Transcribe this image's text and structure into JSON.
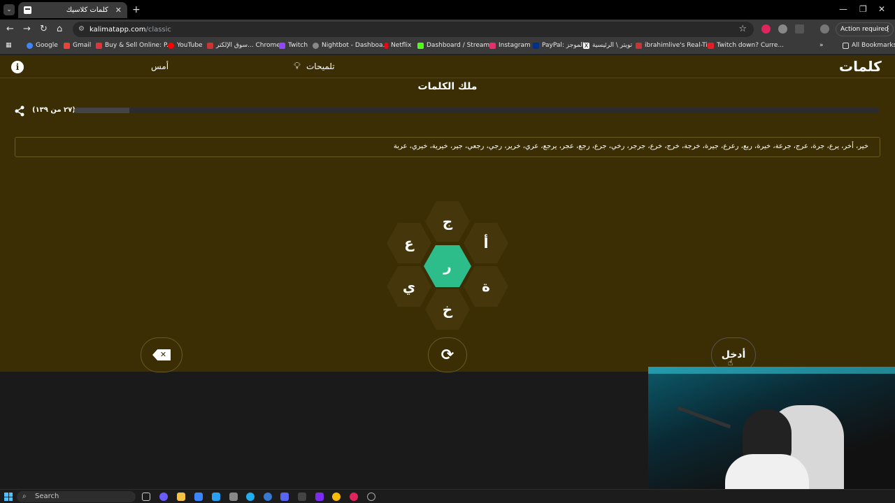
{
  "browser": {
    "tab_title": "كلمات كلاسيك",
    "url_host": "kalimatapp.com",
    "url_path": "/classic",
    "action_required": "Action required",
    "bookmarks": [
      {
        "label": "Google",
        "color": "#4285f4"
      },
      {
        "label": "Gmail",
        "color": "#ea4335"
      },
      {
        "label": "Buy & Sell Online: P...",
        "color": "#e53238"
      },
      {
        "label": "YouTube",
        "color": "#ff0000"
      },
      {
        "label": "سوق الإلكتر... Chrome",
        "color": "#cc3333"
      },
      {
        "label": "Twitch",
        "color": "#9146ff"
      },
      {
        "label": "Nightbot - Dashboa...",
        "color": "#888888"
      },
      {
        "label": "Netflix",
        "color": "#e50914"
      },
      {
        "label": "Dashboard / Stream...",
        "color": "#53fc18"
      },
      {
        "label": "Instagram",
        "color": "#e1306c"
      },
      {
        "label": "PayPal: الموجز",
        "color": "#003087"
      },
      {
        "label": "تويتر \\ الرئيسية",
        "color": "#ffffff"
      },
      {
        "label": "ibrahimlive's Real-Ti...",
        "color": "#cc3333"
      },
      {
        "label": "Twitch down? Curre...",
        "color": "#e31e24"
      }
    ],
    "all_bookmarks": "All Bookmarks"
  },
  "app": {
    "logo": "كلمات",
    "hints_label": "تلميحات",
    "yesterday_label": "أمس",
    "rank_title": "ملك الكلمات",
    "progress_label": "(٢٧ من ١٣٩)",
    "progress_fraction": 0.0686,
    "found_words": "خير، أخر، يرع، جرة، عرج، جرعة، خيرة، ربع، رعرع، جيرة، خرجة، خرج، خرع، جرجر، رخي، جرع، رجع، عجر، يرجع، عري، خرير، رجي، رجعي، جير، خيرية، خيري، عربة",
    "letters": {
      "center": "ر",
      "top": "ج",
      "top_right": "أ",
      "bottom_right": "ة",
      "bottom": "خ",
      "bottom_left": "ي",
      "top_left": "ع"
    },
    "enter_label": "أدخل",
    "accent_color": "#2dbd8b",
    "background_color": "#3b2e04"
  },
  "taskbar": {
    "search_label": "Search"
  }
}
